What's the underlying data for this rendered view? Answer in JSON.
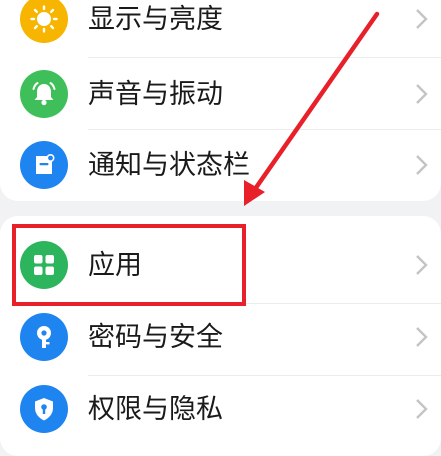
{
  "settings": {
    "items": [
      {
        "label": "显示与亮度",
        "icon": "brightness-icon",
        "color": "#f7b500"
      },
      {
        "label": "声音与振动",
        "icon": "bell-icon",
        "color": "#3fbf5a"
      },
      {
        "label": "通知与状态栏",
        "icon": "notification-icon",
        "color": "#1e84f0"
      },
      {
        "label": "应用",
        "icon": "apps-grid-icon",
        "color": "#2db55d"
      },
      {
        "label": "密码与安全",
        "icon": "key-icon",
        "color": "#1e84f0"
      },
      {
        "label": "权限与隐私",
        "icon": "shield-icon",
        "color": "#1e84f0"
      }
    ]
  },
  "annotation": {
    "color": "#e8202a",
    "highlighted_item": "应用"
  }
}
